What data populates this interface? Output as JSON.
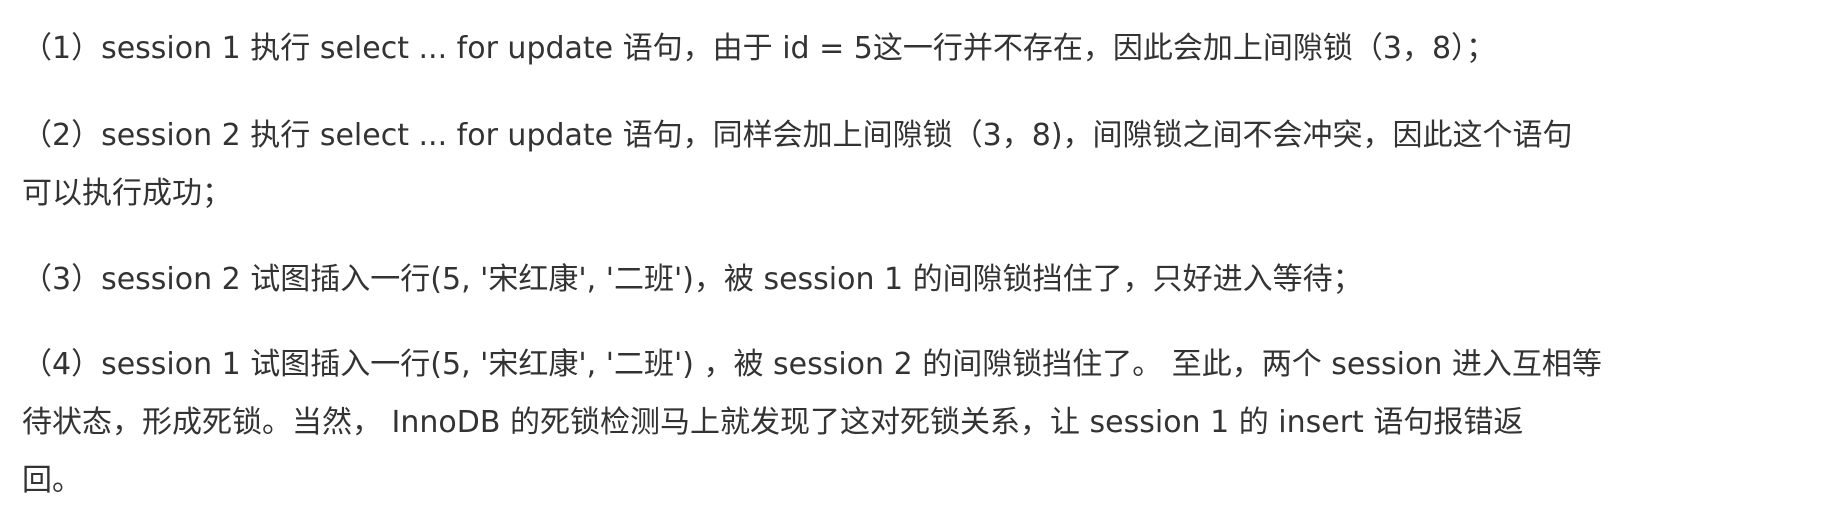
{
  "paragraphs": [
    {
      "lines": [
        "（1）session 1 执行 select ... for update 语句，由于 id = 5这一行并不存在，因此会加上间隙锁（3，8）；"
      ]
    },
    {
      "lines": [
        "（2）session 2 执行 select ... for update 语句，同样会加上间隙锁（3，8)，间隙锁之间不会冲突，因此这个语句",
        "可以执行成功；"
      ]
    },
    {
      "lines": [
        "（3）session 2 试图插入一行(5, '宋红康', '二班')，被 session 1 的间隙锁挡住了，只好进入等待；"
      ]
    },
    {
      "lines": [
        "（4）session 1 试图插入一行(5, '宋红康', '二班') ，被 session 2 的间隙锁挡住了。 至此，两个 session 进入互相等",
        "待状态，形成死锁。当然， InnoDB 的死锁检测马上就发现了这对死锁关系，让 session 1 的 insert 语句报错返",
        "回。"
      ]
    }
  ]
}
